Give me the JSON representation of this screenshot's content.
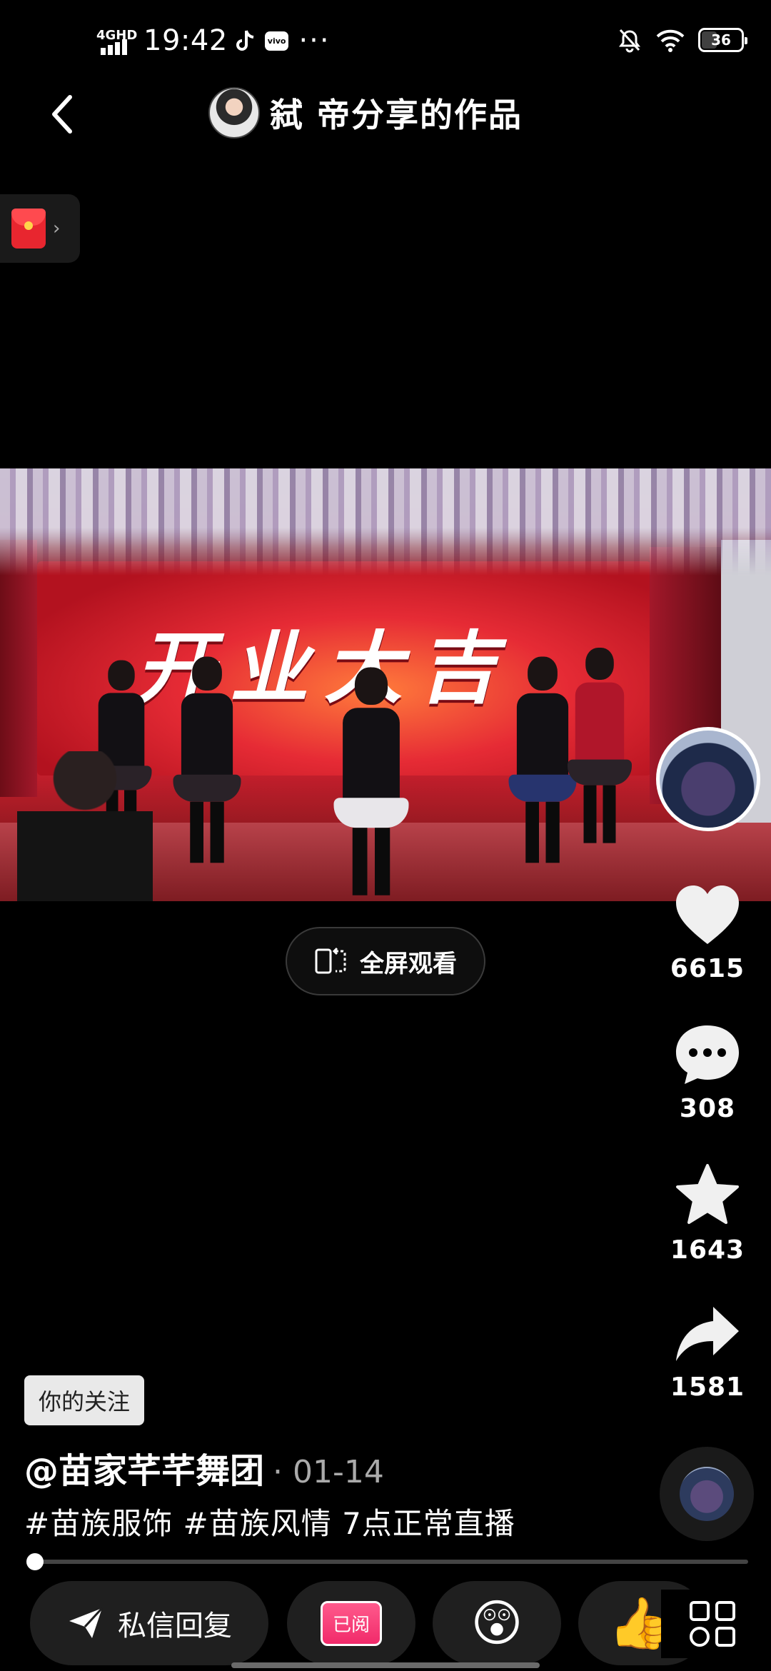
{
  "status_bar": {
    "network": "4GHD",
    "time": "19:42",
    "vivo_icon": "vivo",
    "more": "···",
    "battery": "36",
    "icons": [
      "signal-icon",
      "tiktok-icon",
      "vivo-icon",
      "mute-icon",
      "wifi-icon",
      "battery-icon"
    ]
  },
  "header": {
    "title": "弑  帝分享的作品",
    "back_icon": "back-chevron-icon"
  },
  "red_packet": {
    "icon": "red-envelope-icon",
    "chevron": "›"
  },
  "video": {
    "banner_text": "开业大吉"
  },
  "fullscreen_button": {
    "label": "全屏观看",
    "icon": "rotate-screen-icon"
  },
  "actions": {
    "like_count": "6615",
    "comment_count": "308",
    "favorite_count": "1643",
    "share_count": "1581"
  },
  "info": {
    "follow_badge": "你的关注",
    "author": "@苗家芊芊舞团",
    "date": "· 01-14",
    "caption": "#苗族服饰 #苗族风情 7点正常直播"
  },
  "progress": {
    "fraction": 0.005
  },
  "bottom_bar": {
    "dm_label": "私信回复",
    "read_tag": "已阅",
    "emoji1": "😲",
    "emoji2": "👍",
    "grid_icon": "grid-icon"
  },
  "colors": {
    "background": "#000000",
    "chip": "#1f1f1f",
    "read_tag": "#f12a6a",
    "red_packet": "#e8262f"
  }
}
